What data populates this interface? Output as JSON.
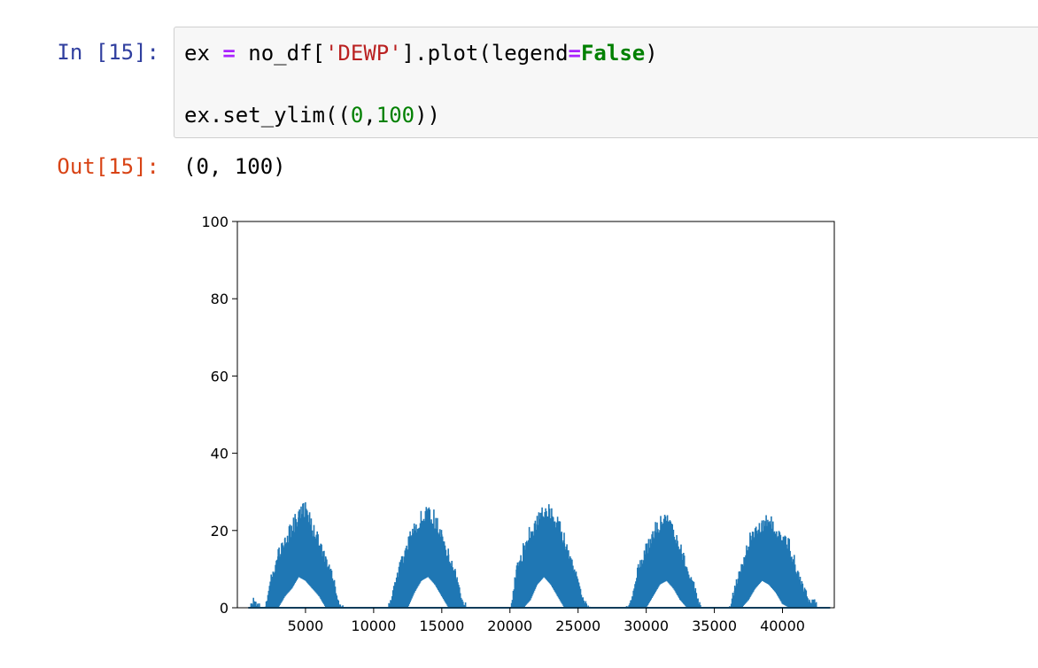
{
  "cell": {
    "in_prompt": "In [15]:",
    "out_prompt": "Out[15]:",
    "code": {
      "line1": {
        "var": "ex",
        "eq": "=",
        "obj": "no_df[",
        "str": "'DEWP'",
        "call": "].plot(legend",
        "eq2": "=",
        "kw": "False",
        "close": ")"
      },
      "line2": {
        "prefix": "ex.set_ylim((",
        "n0": "0",
        "comma": ",",
        "n1": "100",
        "close": "))"
      }
    },
    "output_text": "(0, 100)"
  },
  "chart_data": {
    "type": "line",
    "title": "",
    "xlabel": "",
    "ylabel": "",
    "xlim": [
      0,
      43800
    ],
    "ylim": [
      0,
      100
    ],
    "xticks": [
      5000,
      10000,
      15000,
      20000,
      25000,
      30000,
      35000,
      40000
    ],
    "yticks": [
      0,
      20,
      40,
      60,
      80,
      100
    ],
    "grid": false,
    "legend": false,
    "series_color": "#1f77b4",
    "series": [
      {
        "x": [
          1000,
          1500,
          2000,
          2500,
          3000,
          3500,
          4000,
          4500,
          5000,
          5500,
          6000,
          6500,
          7000,
          7500,
          8000,
          8500,
          9000,
          9500,
          10000,
          10500,
          11000,
          11500,
          12000,
          12500,
          13000,
          13500,
          14000,
          14500,
          15000,
          15500,
          16000,
          16500,
          17000,
          17500,
          18000,
          18500,
          19000,
          19500,
          20000,
          20500,
          21000,
          21500,
          22000,
          22500,
          23000,
          23500,
          24000,
          24500,
          25000,
          25500,
          26000,
          26500,
          27000,
          27500,
          28000,
          28500,
          29000,
          29500,
          30000,
          30500,
          31000,
          31500,
          32000,
          32500,
          33000,
          33500,
          34000,
          34500,
          35000,
          35500,
          36000,
          36500,
          37000,
          37500,
          38000,
          38500,
          39000,
          39500,
          40000,
          40500,
          41000,
          41500,
          42000,
          42500,
          43000,
          43500
        ],
        "upper": [
          3,
          2,
          0,
          9,
          16,
          19,
          23,
          26,
          28,
          23,
          19,
          15,
          9,
          2,
          0,
          0,
          0,
          0,
          0,
          0,
          0,
          6,
          13,
          19,
          22,
          26,
          28,
          25,
          21,
          16,
          10,
          3,
          0,
          0,
          0,
          0,
          0,
          0,
          0,
          11,
          17,
          22,
          24,
          27,
          27,
          24,
          20,
          14,
          8,
          2,
          0,
          0,
          0,
          0,
          0,
          0,
          4,
          13,
          17,
          22,
          24,
          26,
          22,
          17,
          12,
          7,
          1,
          0,
          0,
          0,
          0,
          6,
          12,
          19,
          22,
          24,
          25,
          23,
          20,
          18,
          12,
          6,
          3,
          3
        ],
        "lower": [
          0,
          0,
          0,
          0,
          0,
          3,
          5,
          8,
          7,
          5,
          3,
          0,
          0,
          0,
          0,
          0,
          0,
          0,
          0,
          0,
          0,
          0,
          0,
          0,
          4,
          7,
          8,
          6,
          3,
          0,
          0,
          0,
          0,
          0,
          0,
          0,
          0,
          0,
          0,
          0,
          0,
          2,
          6,
          8,
          6,
          3,
          0,
          0,
          0,
          0,
          0,
          0,
          0,
          0,
          0,
          0,
          0,
          0,
          0,
          3,
          6,
          7,
          5,
          2,
          0,
          0,
          0,
          0,
          0,
          0,
          0,
          0,
          0,
          2,
          5,
          7,
          6,
          4,
          1,
          0,
          0,
          0,
          0,
          0
        ]
      }
    ]
  }
}
